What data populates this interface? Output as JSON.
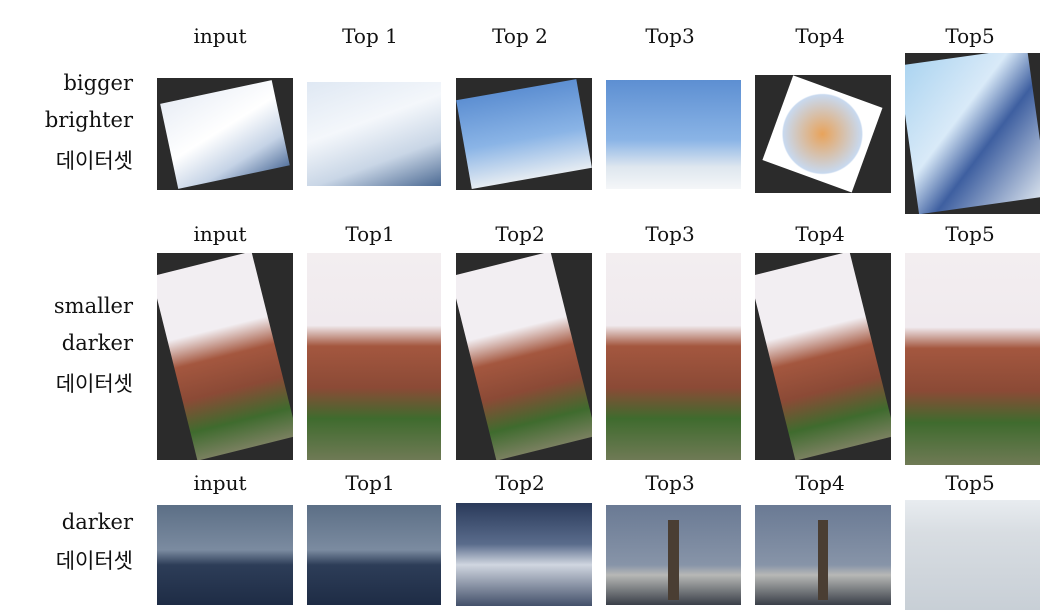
{
  "rows": [
    {
      "label_lines": [
        "bigger",
        "brighter",
        "데이터셋"
      ],
      "headers": [
        "input",
        "Top 1",
        "Top 2",
        "Top3",
        "Top4",
        "Top5"
      ]
    },
    {
      "label_lines": [
        "smaller",
        "darker",
        "데이터셋"
      ],
      "headers": [
        "input",
        "Top1",
        "Top2",
        "Top3",
        "Top4",
        "Top5"
      ]
    },
    {
      "label_lines": [
        "darker",
        "데이터셋"
      ],
      "headers": [
        "input",
        "Top1",
        "Top2",
        "Top3",
        "Top4",
        "Top5"
      ]
    }
  ]
}
